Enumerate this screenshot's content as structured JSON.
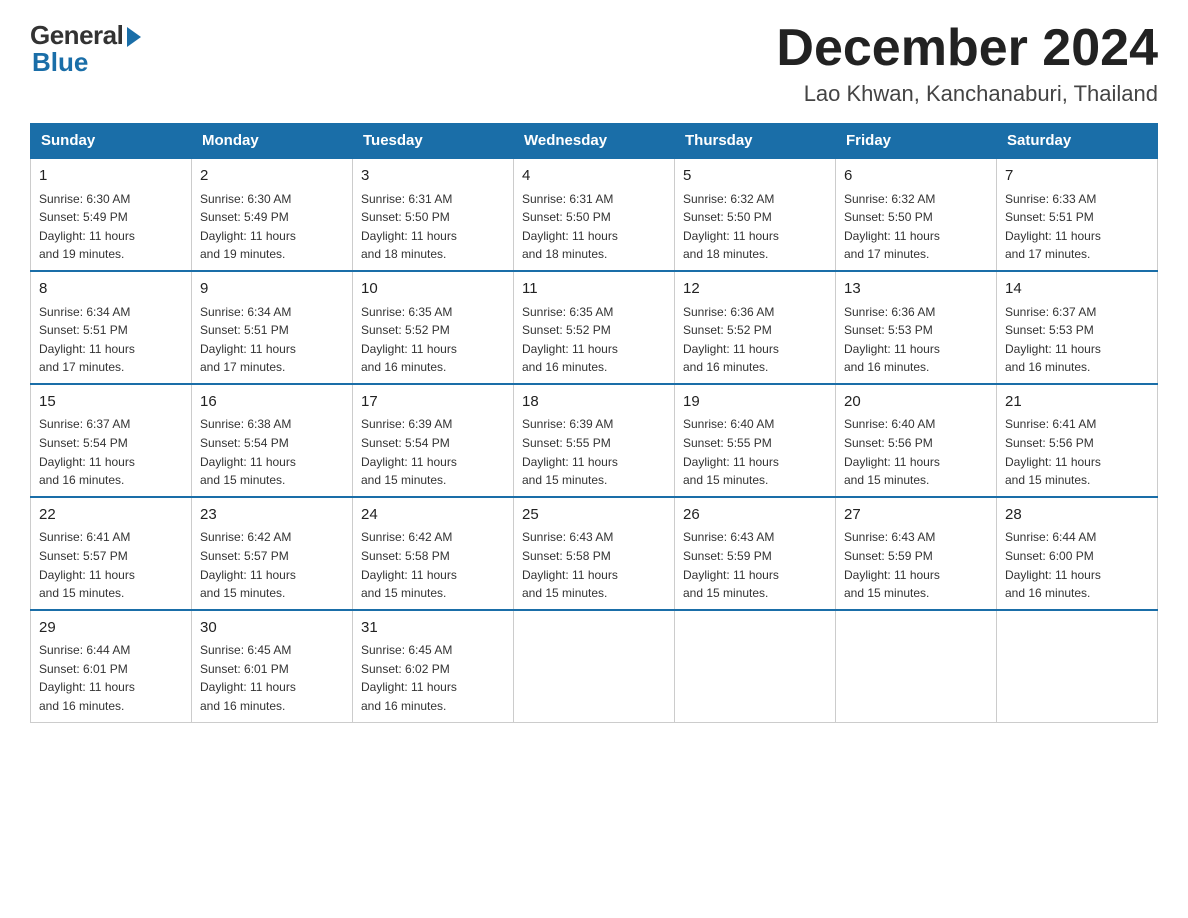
{
  "logo": {
    "general": "General",
    "blue": "Blue"
  },
  "title": "December 2024",
  "subtitle": "Lao Khwan, Kanchanaburi, Thailand",
  "headers": [
    "Sunday",
    "Monday",
    "Tuesday",
    "Wednesday",
    "Thursday",
    "Friday",
    "Saturday"
  ],
  "weeks": [
    [
      {
        "day": "1",
        "sunrise": "6:30 AM",
        "sunset": "5:49 PM",
        "daylight": "11 hours and 19 minutes."
      },
      {
        "day": "2",
        "sunrise": "6:30 AM",
        "sunset": "5:49 PM",
        "daylight": "11 hours and 19 minutes."
      },
      {
        "day": "3",
        "sunrise": "6:31 AM",
        "sunset": "5:50 PM",
        "daylight": "11 hours and 18 minutes."
      },
      {
        "day": "4",
        "sunrise": "6:31 AM",
        "sunset": "5:50 PM",
        "daylight": "11 hours and 18 minutes."
      },
      {
        "day": "5",
        "sunrise": "6:32 AM",
        "sunset": "5:50 PM",
        "daylight": "11 hours and 18 minutes."
      },
      {
        "day": "6",
        "sunrise": "6:32 AM",
        "sunset": "5:50 PM",
        "daylight": "11 hours and 17 minutes."
      },
      {
        "day": "7",
        "sunrise": "6:33 AM",
        "sunset": "5:51 PM",
        "daylight": "11 hours and 17 minutes."
      }
    ],
    [
      {
        "day": "8",
        "sunrise": "6:34 AM",
        "sunset": "5:51 PM",
        "daylight": "11 hours and 17 minutes."
      },
      {
        "day": "9",
        "sunrise": "6:34 AM",
        "sunset": "5:51 PM",
        "daylight": "11 hours and 17 minutes."
      },
      {
        "day": "10",
        "sunrise": "6:35 AM",
        "sunset": "5:52 PM",
        "daylight": "11 hours and 16 minutes."
      },
      {
        "day": "11",
        "sunrise": "6:35 AM",
        "sunset": "5:52 PM",
        "daylight": "11 hours and 16 minutes."
      },
      {
        "day": "12",
        "sunrise": "6:36 AM",
        "sunset": "5:52 PM",
        "daylight": "11 hours and 16 minutes."
      },
      {
        "day": "13",
        "sunrise": "6:36 AM",
        "sunset": "5:53 PM",
        "daylight": "11 hours and 16 minutes."
      },
      {
        "day": "14",
        "sunrise": "6:37 AM",
        "sunset": "5:53 PM",
        "daylight": "11 hours and 16 minutes."
      }
    ],
    [
      {
        "day": "15",
        "sunrise": "6:37 AM",
        "sunset": "5:54 PM",
        "daylight": "11 hours and 16 minutes."
      },
      {
        "day": "16",
        "sunrise": "6:38 AM",
        "sunset": "5:54 PM",
        "daylight": "11 hours and 15 minutes."
      },
      {
        "day": "17",
        "sunrise": "6:39 AM",
        "sunset": "5:54 PM",
        "daylight": "11 hours and 15 minutes."
      },
      {
        "day": "18",
        "sunrise": "6:39 AM",
        "sunset": "5:55 PM",
        "daylight": "11 hours and 15 minutes."
      },
      {
        "day": "19",
        "sunrise": "6:40 AM",
        "sunset": "5:55 PM",
        "daylight": "11 hours and 15 minutes."
      },
      {
        "day": "20",
        "sunrise": "6:40 AM",
        "sunset": "5:56 PM",
        "daylight": "11 hours and 15 minutes."
      },
      {
        "day": "21",
        "sunrise": "6:41 AM",
        "sunset": "5:56 PM",
        "daylight": "11 hours and 15 minutes."
      }
    ],
    [
      {
        "day": "22",
        "sunrise": "6:41 AM",
        "sunset": "5:57 PM",
        "daylight": "11 hours and 15 minutes."
      },
      {
        "day": "23",
        "sunrise": "6:42 AM",
        "sunset": "5:57 PM",
        "daylight": "11 hours and 15 minutes."
      },
      {
        "day": "24",
        "sunrise": "6:42 AM",
        "sunset": "5:58 PM",
        "daylight": "11 hours and 15 minutes."
      },
      {
        "day": "25",
        "sunrise": "6:43 AM",
        "sunset": "5:58 PM",
        "daylight": "11 hours and 15 minutes."
      },
      {
        "day": "26",
        "sunrise": "6:43 AM",
        "sunset": "5:59 PM",
        "daylight": "11 hours and 15 minutes."
      },
      {
        "day": "27",
        "sunrise": "6:43 AM",
        "sunset": "5:59 PM",
        "daylight": "11 hours and 15 minutes."
      },
      {
        "day": "28",
        "sunrise": "6:44 AM",
        "sunset": "6:00 PM",
        "daylight": "11 hours and 16 minutes."
      }
    ],
    [
      {
        "day": "29",
        "sunrise": "6:44 AM",
        "sunset": "6:01 PM",
        "daylight": "11 hours and 16 minutes."
      },
      {
        "day": "30",
        "sunrise": "6:45 AM",
        "sunset": "6:01 PM",
        "daylight": "11 hours and 16 minutes."
      },
      {
        "day": "31",
        "sunrise": "6:45 AM",
        "sunset": "6:02 PM",
        "daylight": "11 hours and 16 minutes."
      },
      null,
      null,
      null,
      null
    ]
  ],
  "labels": {
    "sunrise": "Sunrise:",
    "sunset": "Sunset:",
    "daylight": "Daylight:"
  }
}
